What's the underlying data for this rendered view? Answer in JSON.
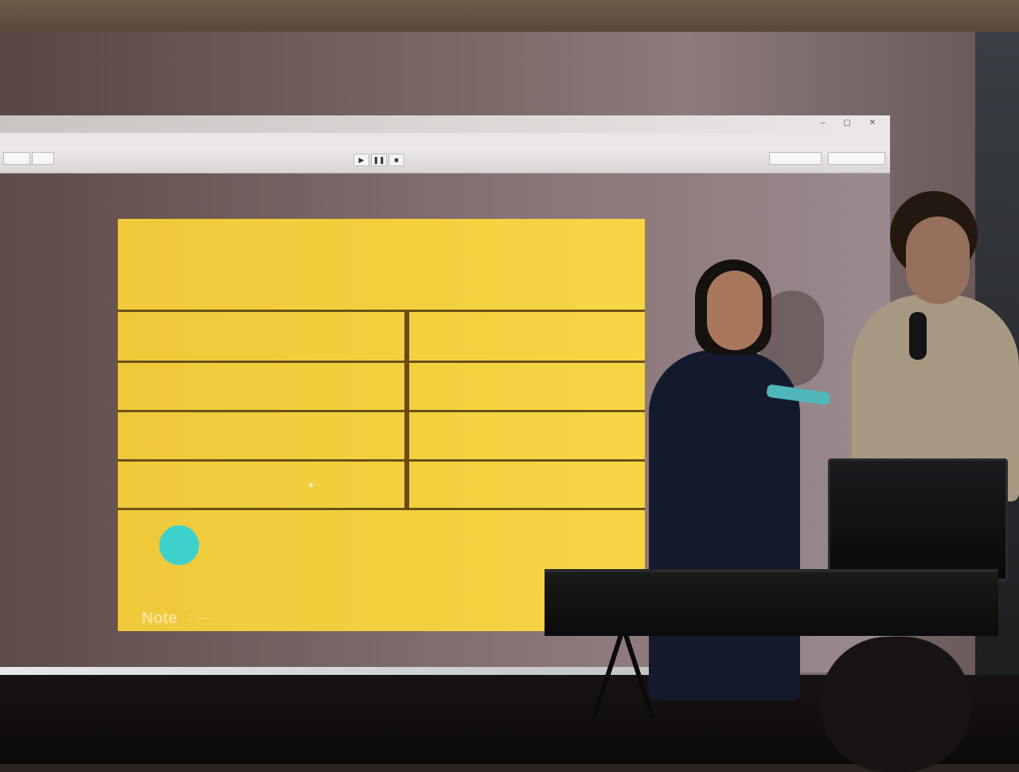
{
  "canvas": {
    "background_color": "#f4d03f",
    "line_color": "#6b5118",
    "ball_color": "#3ed1cc",
    "note_label": "Note",
    "note_value": ":  —"
  },
  "toolbar": {
    "play_icon": "▶",
    "pause_icon": "❚❚",
    "stop_icon": "■"
  },
  "window": {
    "controls": "‒ ▢ ✕"
  }
}
